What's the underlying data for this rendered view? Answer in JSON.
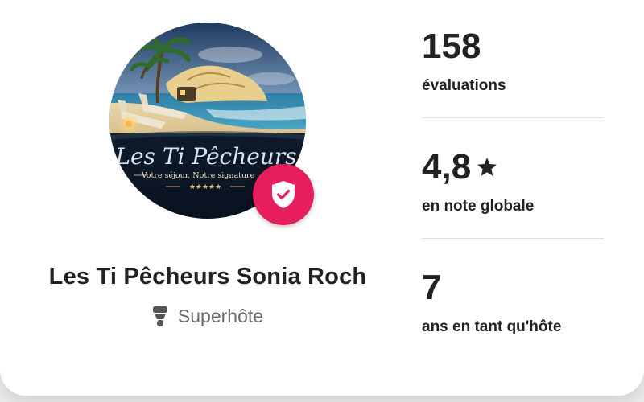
{
  "host": {
    "name": "Les Ti Pêcheurs Sonia Roch",
    "badge_label": "Superhôte",
    "avatar_text": {
      "title": "Les Ti Pêcheurs",
      "tagline": "Votre séjour, Notre signature",
      "stars": "★★★★★"
    }
  },
  "stats": [
    {
      "value": "158",
      "label": "évaluations"
    },
    {
      "value": "4,8",
      "icon": "star-icon",
      "label": "en note globale"
    },
    {
      "value": "7",
      "label": "ans en tant qu'hôte"
    }
  ],
  "colors": {
    "badge": "#e61e5c",
    "text": "#222222",
    "secondary_text": "#6a6a6a",
    "divider": "#dddddd"
  }
}
